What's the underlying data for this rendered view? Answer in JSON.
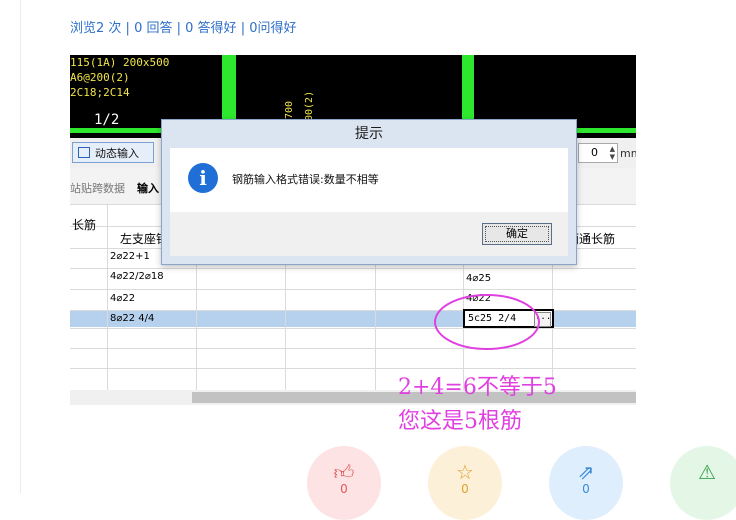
{
  "stats": {
    "views": "浏览2 次",
    "answers": "0 回答",
    "good_answers": "0 答得好",
    "good_questions": "0问得好",
    "sep": "|"
  },
  "cad": {
    "line1": "115(1A) 200x500",
    "line2": "A6@200(2)",
    "line3": "2C18;2C14",
    "span": "1/2",
    "rot1": "x700",
    "rot2": "00(2)"
  },
  "toolbar": {
    "dynamic_input": "动态输入",
    "spinner_value": "0",
    "unit": "mm"
  },
  "tabs": {
    "paste_data": "站贴跨数据",
    "input": "输入"
  },
  "grid": {
    "header_row1_col0": "长筋",
    "header_left_seat": "左支座钢",
    "header_right_long": "面通长筋",
    "rows": [
      {
        "left": "2⌀22+1",
        "right": ""
      },
      {
        "left": "4⌀22/2⌀18",
        "right": "4⌀25"
      },
      {
        "left": "4⌀22",
        "right": "4⌀22"
      },
      {
        "left": "8⌀22 4/4",
        "right": "5c25 2/4"
      }
    ],
    "dots": "..."
  },
  "dialog": {
    "title": "提示",
    "message": "钢筋输入格式错误:数量不相等",
    "ok_label": "确定",
    "icon": "info-icon"
  },
  "annotation": {
    "line1": "2+4=6不等于5",
    "line2": "您这是5根筋"
  },
  "actions": {
    "like_count": "0",
    "star_count": "0",
    "share_count": "0"
  },
  "colors": {
    "accent": "#2f6fc9",
    "annotation": "#e040e0",
    "cad_green": "#2ee82e",
    "info_blue": "#1f6fd6"
  }
}
